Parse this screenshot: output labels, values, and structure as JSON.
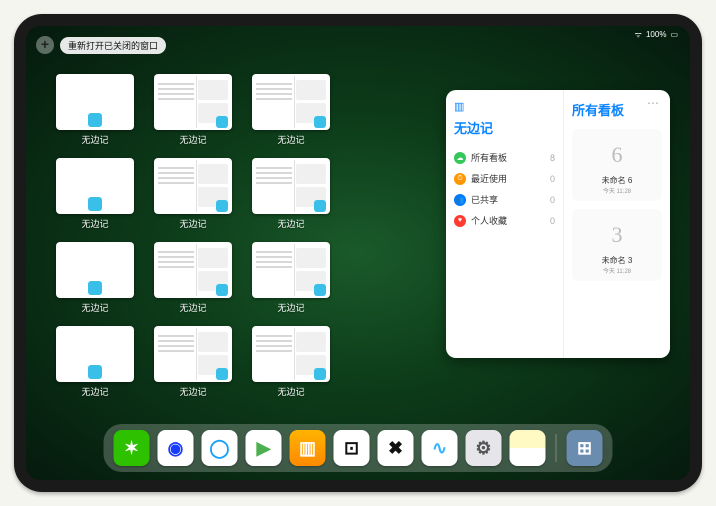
{
  "status": {
    "battery": "100%"
  },
  "top": {
    "plus": "+",
    "reopen_label": "重新打开已关闭的窗口"
  },
  "thumbs": {
    "label": "无边记",
    "items": [
      {
        "style": "blank"
      },
      {
        "style": "split"
      },
      {
        "style": "split"
      },
      null,
      {
        "style": "blank"
      },
      {
        "style": "split"
      },
      {
        "style": "split"
      },
      null,
      {
        "style": "blank"
      },
      {
        "style": "split"
      },
      {
        "style": "split"
      },
      null,
      {
        "style": "blank"
      },
      {
        "style": "split"
      },
      {
        "style": "split"
      }
    ]
  },
  "panel": {
    "left": {
      "title": "无边记",
      "rows": [
        {
          "color": "#34c759",
          "glyph": "☁",
          "label": "所有看板",
          "count": "8"
        },
        {
          "color": "#ff9500",
          "glyph": "⏱",
          "label": "最近使用",
          "count": "0"
        },
        {
          "color": "#007aff",
          "glyph": "👥",
          "label": "已共享",
          "count": "0"
        },
        {
          "color": "#ff3b30",
          "glyph": "♥",
          "label": "个人收藏",
          "count": "0"
        }
      ]
    },
    "right": {
      "title": "所有看板",
      "boards": [
        {
          "glyph": "6",
          "name": "未命名 6",
          "time": "今天 11:28"
        },
        {
          "glyph": "3",
          "name": "未命名 3",
          "time": "今天 11:28"
        }
      ]
    }
  },
  "dock": {
    "apps": [
      {
        "name": "wechat",
        "bg": "#2dc100",
        "fg": "#fff",
        "glyph": "✶"
      },
      {
        "name": "quark",
        "bg": "#fff",
        "fg": "#1a3cff",
        "glyph": "◉"
      },
      {
        "name": "qqbrowser",
        "bg": "#fff",
        "fg": "#18a0fb",
        "glyph": "◯"
      },
      {
        "name": "play",
        "bg": "#fff",
        "fg": "#4caf50",
        "glyph": "▶"
      },
      {
        "name": "books",
        "bg": "linear-gradient(#ffb300,#ff8a00)",
        "fg": "#fff",
        "glyph": "▥"
      },
      {
        "name": "dice",
        "bg": "#fff",
        "fg": "#111",
        "glyph": "⊡"
      },
      {
        "name": "x-app",
        "bg": "#fff",
        "fg": "#111",
        "glyph": "✖"
      },
      {
        "name": "freeform",
        "bg": "#fff",
        "fg": "#36b5ff",
        "glyph": "∿"
      },
      {
        "name": "settings",
        "bg": "#e5e5ea",
        "fg": "#555",
        "glyph": "⚙"
      },
      {
        "name": "notes",
        "bg": "linear-gradient(#fff9c4 50%,#fff 50%)",
        "fg": "#888",
        "glyph": ""
      },
      {
        "name": "app-library",
        "bg": "#6a8caf",
        "fg": "#fff",
        "glyph": "⊞"
      }
    ]
  }
}
